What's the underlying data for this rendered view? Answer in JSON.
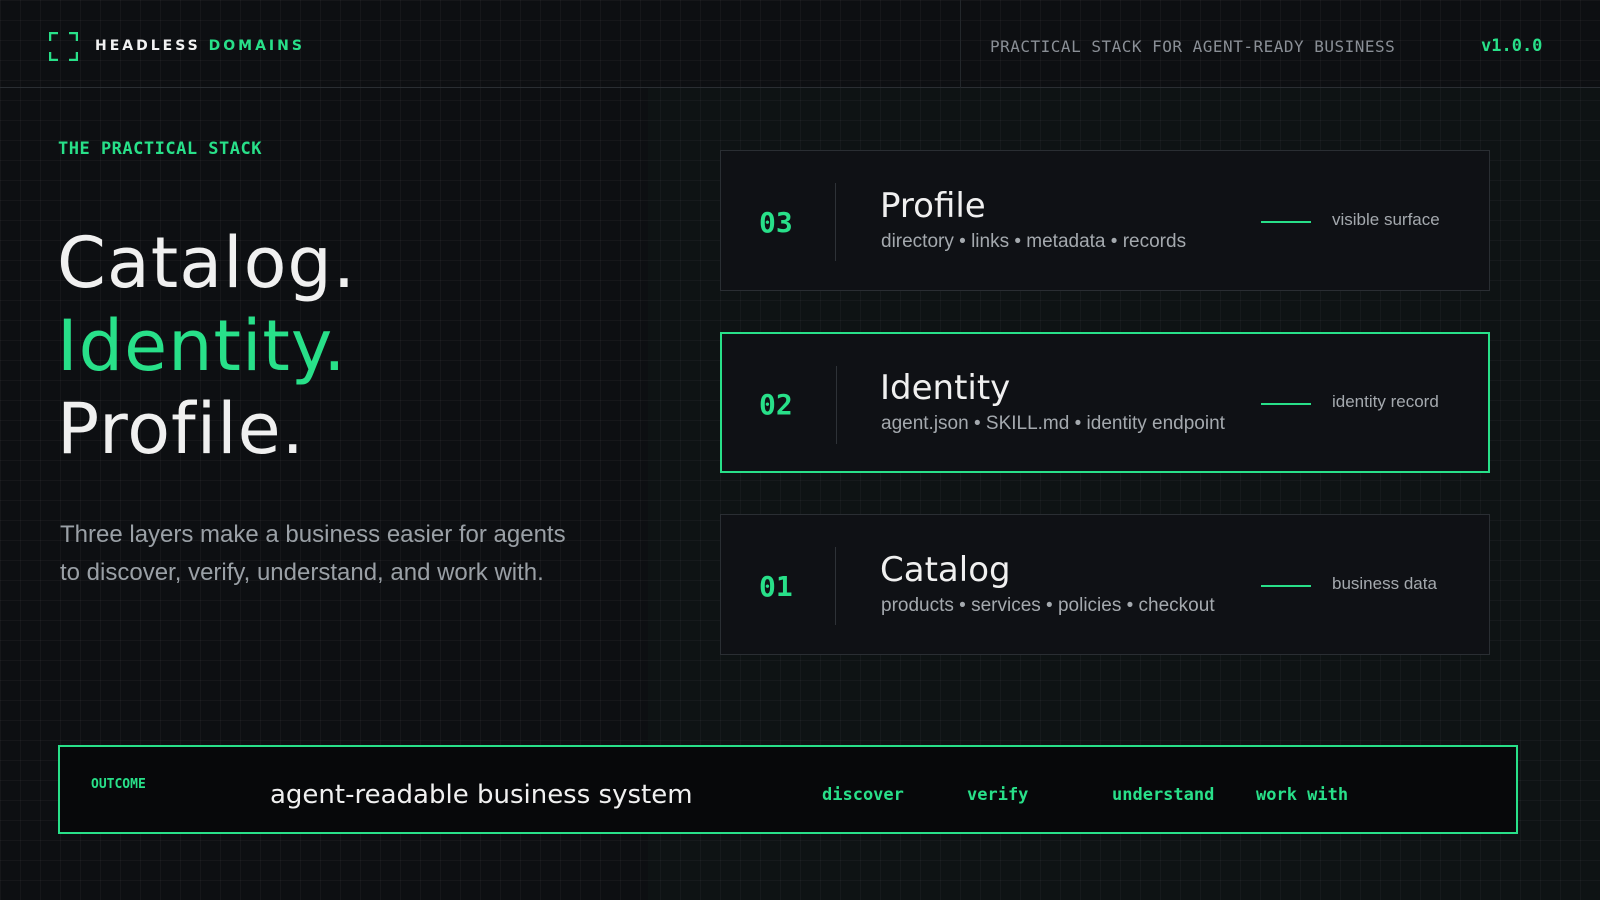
{
  "header": {
    "brand_primary": "HEADLESS",
    "brand_accent": "DOMAINS",
    "logo_icon": "bracket-frame-icon",
    "tagline": "PRACTICAL STACK FOR AGENT-READY BUSINESS",
    "version": "v1.0.0"
  },
  "hero": {
    "eyebrow": "THE PRACTICAL STACK",
    "headline": [
      "Catalog.",
      "Identity.",
      "Profile."
    ],
    "description": "Three layers make a business easier for agents to discover, verify, understand, and work with."
  },
  "layers": [
    {
      "number": "03",
      "title": "Profile",
      "items": "directory • links • metadata • records",
      "role": "visible surface",
      "active": false
    },
    {
      "number": "02",
      "title": "Identity",
      "items": "agent.json • SKILL.md • identity endpoint",
      "role": "identity record",
      "active": true
    },
    {
      "number": "01",
      "title": "Catalog",
      "items": "products • services • policies • checkout",
      "role": "business data",
      "active": false
    }
  ],
  "outcome": {
    "label": "OUTCOME",
    "text": "agent-readable business system",
    "verbs": [
      "discover",
      "verify",
      "understand",
      "work with"
    ]
  },
  "colors": {
    "accent": "#28e089",
    "background": "#0d0f12",
    "card": "#0f1115"
  }
}
